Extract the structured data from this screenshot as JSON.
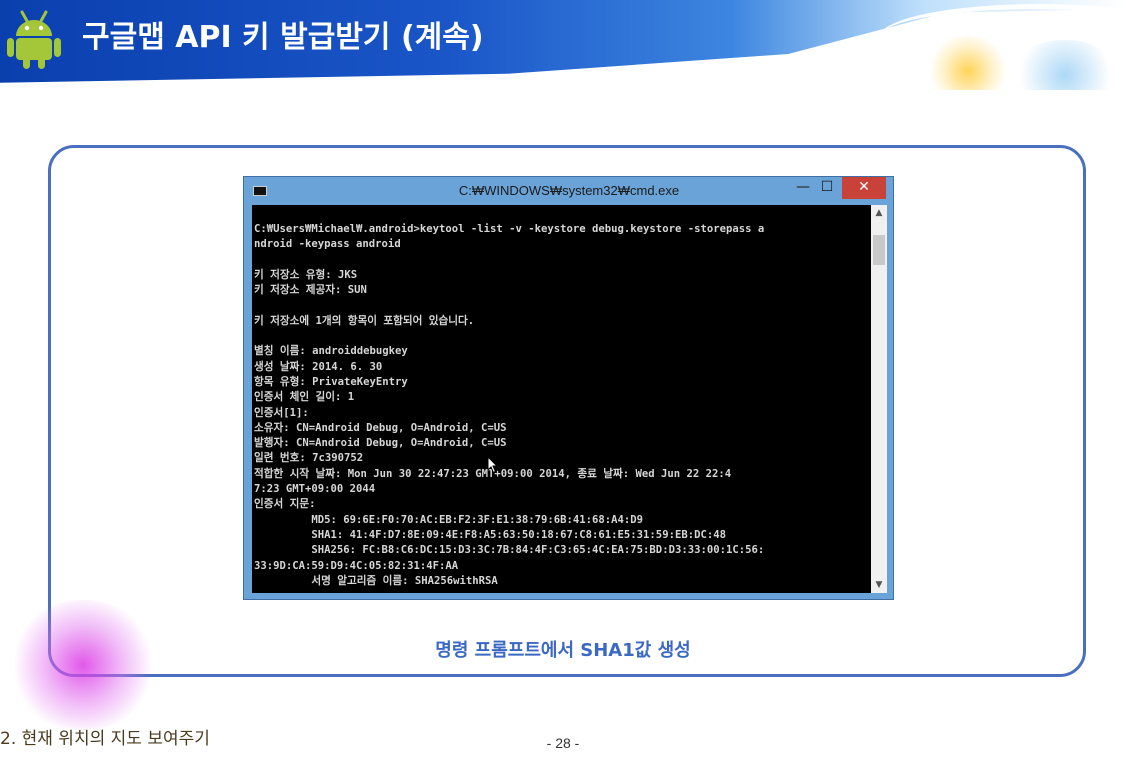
{
  "slide": {
    "title": "구글맵 API 키 발급받기 (계속)",
    "caption": "명령 프롬프트에서 SHA1값 생성",
    "footer_nav": "2. 현재 위치의 지도 보여주기",
    "page_number": "- 28 -"
  },
  "cmd_window": {
    "title": "C:₩WINDOWS₩system32₩cmd.exe",
    "minimize": "—",
    "maximize": "☐",
    "close": "✕",
    "lines": [
      "C:₩Users₩Michael₩.android>keytool -list -v -keystore debug.keystore -storepass a",
      "ndroid -keypass android",
      "",
      "키 저장소 유형: JKS",
      "키 저장소 제공자: SUN",
      "",
      "키 저장소에 1개의 항목이 포함되어 있습니다.",
      "",
      "별칭 이름: androiddebugkey",
      "생성 날짜: 2014. 6. 30",
      "항목 유형: PrivateKeyEntry",
      "인증서 체인 길이: 1",
      "인증서[1]:",
      "소유자: CN=Android Debug, O=Android, C=US",
      "발행자: CN=Android Debug, O=Android, C=US",
      "일련 번호: 7c390752",
      "적합한 시작 날짜: Mon Jun 30 22:47:23 GMT+09:00 2014, 종료 날짜: Wed Jun 22 22:4",
      "7:23 GMT+09:00 2044",
      "인증서 지문:",
      "         MD5: 69:6E:F0:70:AC:EB:F2:3F:E1:38:79:6B:41:68:A4:D9",
      "         SHA1: 41:4F:D7:8E:09:4E:F8:A5:63:50:18:67:C8:61:E5:31:59:EB:DC:48",
      "         SHA256: FC:B8:C6:DC:15:D3:3C:7B:84:4F:C3:65:4C:EA:75:BD:D3:33:00:1C:56:",
      "33:9D:CA:59:D9:4C:05:82:31:4F:AA",
      "         서명 알고리즘 이름: SHA256withRSA"
    ]
  }
}
